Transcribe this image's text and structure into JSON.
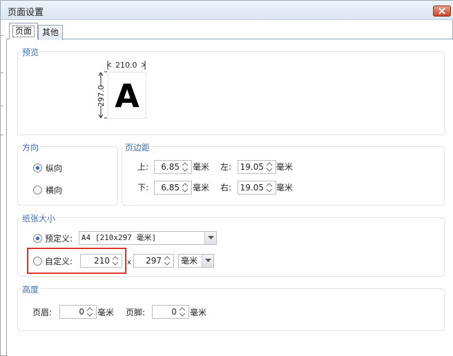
{
  "window": {
    "title": "页面设置"
  },
  "tabs": [
    {
      "label": "页面",
      "active": true
    },
    {
      "label": "其他",
      "active": false
    }
  ],
  "preview": {
    "group_title": "预览",
    "width_label": "210.0",
    "height_label": "297.0",
    "letter": "A"
  },
  "orientation": {
    "group_title": "方向",
    "options": [
      {
        "label": "纵向",
        "checked": true
      },
      {
        "label": "横向",
        "checked": false
      }
    ]
  },
  "margins": {
    "group_title": "页边距",
    "top": {
      "label": "上:",
      "value": "6.85",
      "unit": "毫米"
    },
    "left": {
      "label": "左:",
      "value": "19.05",
      "unit": "毫米"
    },
    "bottom": {
      "label": "下:",
      "value": "6.85",
      "unit": "毫米"
    },
    "right": {
      "label": "右:",
      "value": "19.05",
      "unit": "毫米"
    }
  },
  "paper_size": {
    "group_title": "纸张大小",
    "predefined": {
      "label": "预定义:",
      "checked": true,
      "value": "A4 [210x297 毫米]"
    },
    "custom": {
      "label": "自定义:",
      "checked": false,
      "width": "210",
      "separator": "x",
      "height": "297",
      "unit": "毫米"
    }
  },
  "height": {
    "group_title": "高度",
    "header": {
      "label": "页眉:",
      "value": "0",
      "unit": "毫米"
    },
    "footer": {
      "label": "页脚:",
      "value": "0",
      "unit": "毫米"
    }
  },
  "colors": {
    "accent": "#3b6fb6",
    "radio_dot": "#2468c4",
    "highlight": "#e0332e"
  }
}
